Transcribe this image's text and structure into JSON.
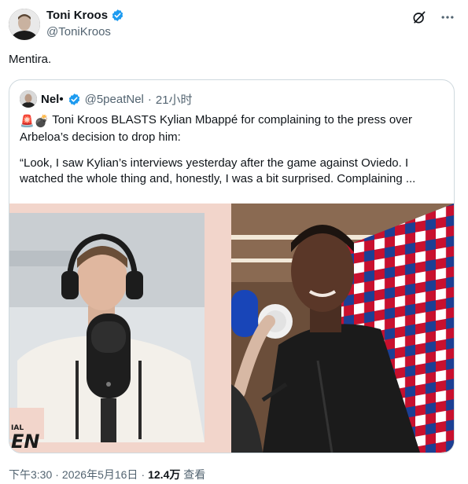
{
  "author": {
    "name": "Toni Kroos",
    "handle": "@ToniKroos"
  },
  "tweet": {
    "text": "Mentira."
  },
  "quote": {
    "name": "Nel•",
    "handle": "@5peatNel",
    "separator": "·",
    "time": "21小时",
    "emoji": "🚨💣",
    "line1": "Toni Kroos BLASTS Kylian Mbappé for complaining to the press over Arbeloa’s decision to drop him:",
    "line2": "“Look, I saw Kylian’s interviews yesterday after the game against Oviedo. I watched the whole thing and, honestly, I was a bit surprised. Complaining ...",
    "media_left_caption": "EN",
    "media_left_caption_small": "IAL"
  },
  "footer": {
    "time": "下午3:30",
    "dot": "·",
    "date": "2026年5月16日",
    "views_count": "12.4万",
    "views_label": "查看"
  },
  "colors": {
    "verified": "#1d9bf0",
    "text": "#0f1419",
    "muted": "#536471",
    "border": "#cfd9de",
    "podcast_bg": "#f2d5cb",
    "backdrop_red": "#c8102e"
  },
  "icons": {
    "verified": "verified-badge-icon",
    "grok": "grok-icon",
    "more": "more-icon"
  }
}
